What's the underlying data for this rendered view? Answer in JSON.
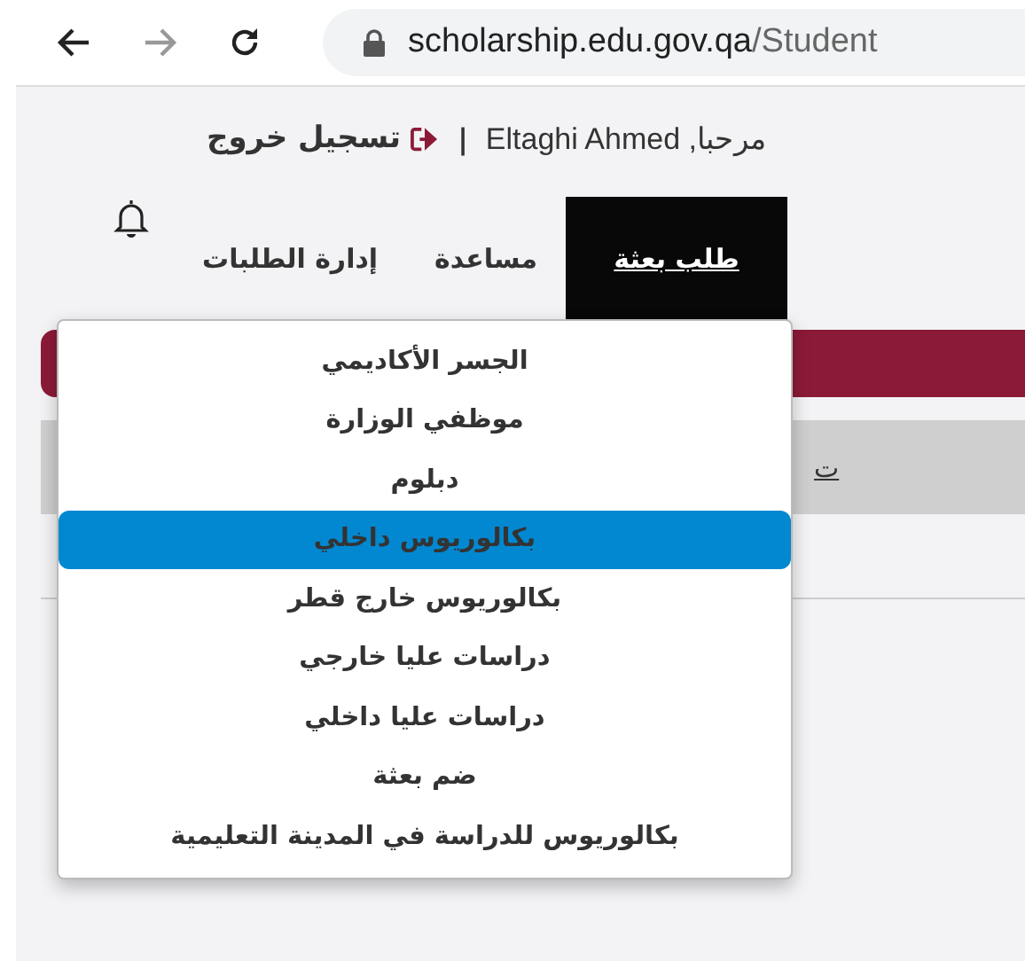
{
  "browser": {
    "nav_buttons": [
      {
        "kind": "back",
        "disabled": false
      },
      {
        "kind": "forward",
        "disabled": true
      },
      {
        "kind": "reload",
        "disabled": false
      }
    ],
    "url_host": "scholarship.edu.gov.qa",
    "url_path": "/Student"
  },
  "header": {
    "greeting": "مرحبا,",
    "user": "Eltaghi Ahmed",
    "separator": "|",
    "logout": "تسجيل خروج"
  },
  "nav": {
    "tabs": [
      {
        "label": "طلب بعثة",
        "selected": true
      },
      {
        "label": "مساعدة",
        "selected": false
      },
      {
        "label": "إدارة الطلبات",
        "selected": false
      }
    ]
  },
  "sub_bar": {
    "link": "ت"
  },
  "dropdown": {
    "items": [
      {
        "label": "الجسر الأكاديمي",
        "selected": false
      },
      {
        "label": "موظفي الوزارة",
        "selected": false
      },
      {
        "label": "دبلوم",
        "selected": false
      },
      {
        "label": "بكالوريوس داخلي",
        "selected": true
      },
      {
        "label": "بكالوريوس خارج قطر",
        "selected": false
      },
      {
        "label": "دراسات عليا خارجي",
        "selected": false
      },
      {
        "label": "دراسات عليا داخلي",
        "selected": false
      },
      {
        "label": "ضم بعثة",
        "selected": false
      },
      {
        "label": "بكالوريوس للدراسة في المدينة التعليمية",
        "selected": false
      }
    ]
  }
}
